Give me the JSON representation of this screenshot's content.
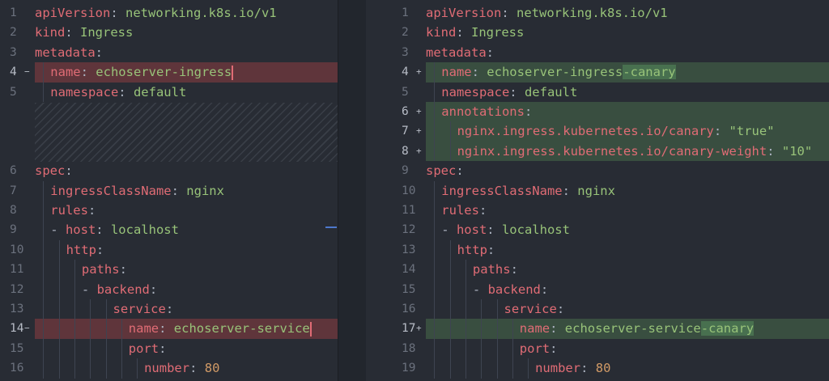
{
  "left": {
    "lines": [
      {
        "num": "1",
        "mark": "",
        "type": "",
        "indent": 0,
        "tokens": [
          {
            "t": "k",
            "v": "apiVersion"
          },
          {
            "t": "p",
            "v": ": "
          },
          {
            "t": "s",
            "v": "networking.k8s.io/v1"
          }
        ]
      },
      {
        "num": "2",
        "mark": "",
        "type": "",
        "indent": 0,
        "tokens": [
          {
            "t": "k",
            "v": "kind"
          },
          {
            "t": "p",
            "v": ": "
          },
          {
            "t": "s",
            "v": "Ingress"
          }
        ]
      },
      {
        "num": "3",
        "mark": "",
        "type": "",
        "indent": 0,
        "tokens": [
          {
            "t": "k",
            "v": "metadata"
          },
          {
            "t": "p",
            "v": ":"
          }
        ]
      },
      {
        "num": "4",
        "mark": "−",
        "type": "del",
        "indent": 1,
        "tokens": [
          {
            "t": "k",
            "v": "name"
          },
          {
            "t": "p",
            "v": ": "
          },
          {
            "t": "s",
            "v": "echoserver-ingress"
          },
          {
            "t": "cursor",
            "v": ""
          }
        ]
      },
      {
        "num": "5",
        "mark": "",
        "type": "",
        "indent": 1,
        "tokens": [
          {
            "t": "k",
            "v": "namespace"
          },
          {
            "t": "p",
            "v": ": "
          },
          {
            "t": "s",
            "v": "default"
          }
        ]
      },
      {
        "num": "6",
        "mark": "",
        "type": "",
        "indent": 0,
        "tokens": [
          {
            "t": "k",
            "v": "spec"
          },
          {
            "t": "p",
            "v": ":"
          }
        ]
      },
      {
        "num": "7",
        "mark": "",
        "type": "",
        "indent": 1,
        "tokens": [
          {
            "t": "k",
            "v": "ingressClassName"
          },
          {
            "t": "p",
            "v": ": "
          },
          {
            "t": "s",
            "v": "nginx"
          }
        ]
      },
      {
        "num": "8",
        "mark": "",
        "type": "",
        "indent": 1,
        "tokens": [
          {
            "t": "k",
            "v": "rules"
          },
          {
            "t": "p",
            "v": ":"
          }
        ]
      },
      {
        "num": "9",
        "mark": "",
        "type": "",
        "indent": 1,
        "tokens": [
          {
            "t": "p",
            "v": "- "
          },
          {
            "t": "k",
            "v": "host"
          },
          {
            "t": "p",
            "v": ": "
          },
          {
            "t": "s",
            "v": "localhost"
          }
        ]
      },
      {
        "num": "10",
        "mark": "",
        "type": "",
        "indent": 2,
        "tokens": [
          {
            "t": "k",
            "v": "http"
          },
          {
            "t": "p",
            "v": ":"
          }
        ]
      },
      {
        "num": "11",
        "mark": "",
        "type": "",
        "indent": 3,
        "tokens": [
          {
            "t": "k",
            "v": "paths"
          },
          {
            "t": "p",
            "v": ":"
          }
        ]
      },
      {
        "num": "12",
        "mark": "",
        "type": "",
        "indent": 3,
        "tokens": [
          {
            "t": "p",
            "v": "- "
          },
          {
            "t": "k",
            "v": "backend"
          },
          {
            "t": "p",
            "v": ":"
          }
        ]
      },
      {
        "num": "13",
        "mark": "",
        "type": "",
        "indent": 5,
        "tokens": [
          {
            "t": "k",
            "v": "service"
          },
          {
            "t": "p",
            "v": ":"
          }
        ]
      },
      {
        "num": "14",
        "mark": "−",
        "type": "del",
        "indent": 6,
        "tokens": [
          {
            "t": "k",
            "v": "name"
          },
          {
            "t": "p",
            "v": ": "
          },
          {
            "t": "s",
            "v": "echoserver-service"
          },
          {
            "t": "cursor",
            "v": ""
          }
        ]
      },
      {
        "num": "15",
        "mark": "",
        "type": "",
        "indent": 6,
        "tokens": [
          {
            "t": "k",
            "v": "port"
          },
          {
            "t": "p",
            "v": ":"
          }
        ]
      },
      {
        "num": "16",
        "mark": "",
        "type": "",
        "indent": 7,
        "tokens": [
          {
            "t": "k",
            "v": "number"
          },
          {
            "t": "p",
            "v": ": "
          },
          {
            "t": "n",
            "v": "80"
          }
        ]
      }
    ]
  },
  "right": {
    "lines": [
      {
        "num": "1",
        "mark": "",
        "type": "",
        "indent": 0,
        "tokens": [
          {
            "t": "k",
            "v": "apiVersion"
          },
          {
            "t": "p",
            "v": ": "
          },
          {
            "t": "s",
            "v": "networking.k8s.io/v1"
          }
        ]
      },
      {
        "num": "2",
        "mark": "",
        "type": "",
        "indent": 0,
        "tokens": [
          {
            "t": "k",
            "v": "kind"
          },
          {
            "t": "p",
            "v": ": "
          },
          {
            "t": "s",
            "v": "Ingress"
          }
        ]
      },
      {
        "num": "3",
        "mark": "",
        "type": "",
        "indent": 0,
        "tokens": [
          {
            "t": "k",
            "v": "metadata"
          },
          {
            "t": "p",
            "v": ":"
          }
        ]
      },
      {
        "num": "4",
        "mark": "+",
        "type": "add",
        "indent": 1,
        "tokens": [
          {
            "t": "k",
            "v": "name"
          },
          {
            "t": "p",
            "v": ": "
          },
          {
            "t": "s",
            "v": "echoserver-ingress"
          },
          {
            "t": "s-add",
            "v": "-canary"
          }
        ]
      },
      {
        "num": "5",
        "mark": "",
        "type": "",
        "indent": 1,
        "tokens": [
          {
            "t": "k",
            "v": "namespace"
          },
          {
            "t": "p",
            "v": ": "
          },
          {
            "t": "s",
            "v": "default"
          }
        ]
      },
      {
        "num": "6",
        "mark": "+",
        "type": "add",
        "indent": 1,
        "tokens": [
          {
            "t": "k",
            "v": "annotations"
          },
          {
            "t": "p",
            "v": ":"
          }
        ]
      },
      {
        "num": "7",
        "mark": "+",
        "type": "add",
        "indent": 2,
        "tokens": [
          {
            "t": "k",
            "v": "nginx.ingress.kubernetes.io/canary"
          },
          {
            "t": "p",
            "v": ": "
          },
          {
            "t": "s",
            "v": "\"true\""
          }
        ]
      },
      {
        "num": "8",
        "mark": "+",
        "type": "add",
        "indent": 2,
        "tokens": [
          {
            "t": "k",
            "v": "nginx.ingress.kubernetes.io/canary-weight"
          },
          {
            "t": "p",
            "v": ": "
          },
          {
            "t": "s",
            "v": "\"10\""
          }
        ]
      },
      {
        "num": "9",
        "mark": "",
        "type": "",
        "indent": 0,
        "tokens": [
          {
            "t": "k",
            "v": "spec"
          },
          {
            "t": "p",
            "v": ":"
          }
        ]
      },
      {
        "num": "10",
        "mark": "",
        "type": "",
        "indent": 1,
        "tokens": [
          {
            "t": "k",
            "v": "ingressClassName"
          },
          {
            "t": "p",
            "v": ": "
          },
          {
            "t": "s",
            "v": "nginx"
          }
        ]
      },
      {
        "num": "11",
        "mark": "",
        "type": "",
        "indent": 1,
        "tokens": [
          {
            "t": "k",
            "v": "rules"
          },
          {
            "t": "p",
            "v": ":"
          }
        ]
      },
      {
        "num": "12",
        "mark": "",
        "type": "",
        "indent": 1,
        "tokens": [
          {
            "t": "p",
            "v": "- "
          },
          {
            "t": "k",
            "v": "host"
          },
          {
            "t": "p",
            "v": ": "
          },
          {
            "t": "s",
            "v": "localhost"
          }
        ]
      },
      {
        "num": "13",
        "mark": "",
        "type": "",
        "indent": 2,
        "tokens": [
          {
            "t": "k",
            "v": "http"
          },
          {
            "t": "p",
            "v": ":"
          }
        ]
      },
      {
        "num": "14",
        "mark": "",
        "type": "",
        "indent": 3,
        "tokens": [
          {
            "t": "k",
            "v": "paths"
          },
          {
            "t": "p",
            "v": ":"
          }
        ]
      },
      {
        "num": "15",
        "mark": "",
        "type": "",
        "indent": 3,
        "tokens": [
          {
            "t": "p",
            "v": "- "
          },
          {
            "t": "k",
            "v": "backend"
          },
          {
            "t": "p",
            "v": ":"
          }
        ]
      },
      {
        "num": "16",
        "mark": "",
        "type": "",
        "indent": 5,
        "tokens": [
          {
            "t": "k",
            "v": "service"
          },
          {
            "t": "p",
            "v": ":"
          }
        ]
      },
      {
        "num": "17",
        "mark": "+",
        "type": "add",
        "indent": 6,
        "tokens": [
          {
            "t": "k",
            "v": "name"
          },
          {
            "t": "p",
            "v": ": "
          },
          {
            "t": "s",
            "v": "echoserver-service"
          },
          {
            "t": "s-add",
            "v": "-canary"
          }
        ]
      },
      {
        "num": "18",
        "mark": "",
        "type": "",
        "indent": 6,
        "tokens": [
          {
            "t": "k",
            "v": "port"
          },
          {
            "t": "p",
            "v": ":"
          }
        ]
      },
      {
        "num": "19",
        "mark": "",
        "type": "",
        "indent": 7,
        "tokens": [
          {
            "t": "k",
            "v": "number"
          },
          {
            "t": "p",
            "v": ": "
          },
          {
            "t": "n",
            "v": "80"
          }
        ]
      }
    ]
  },
  "colors": {
    "background": "#282c34",
    "key": "#e06c75",
    "string": "#98c379",
    "number": "#d19a66",
    "deletion": "#e04c4c",
    "addition": "#78c86e"
  }
}
